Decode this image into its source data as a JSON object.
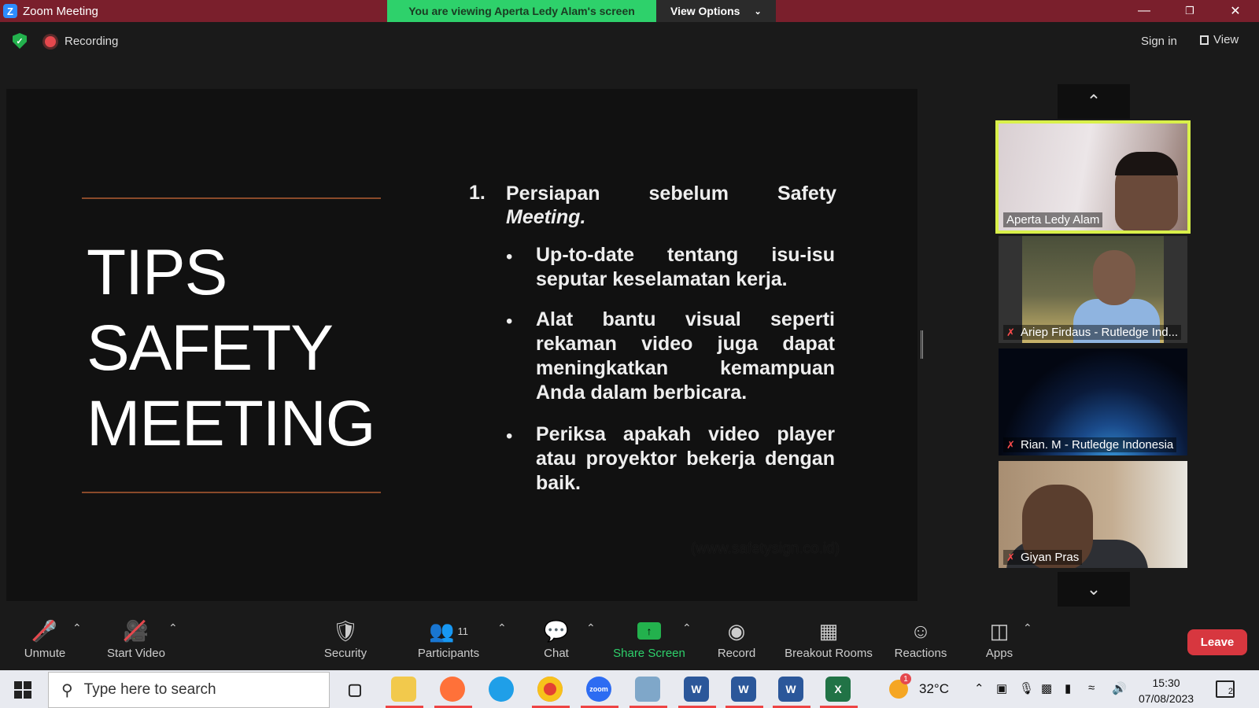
{
  "window": {
    "app_title": "Zoom Meeting",
    "logo_letter": "Z",
    "viewing_banner": "You are viewing Aperta Ledy Alam's screen",
    "view_options": "View Options",
    "minimize": "—",
    "restore": "❐",
    "close": "✕"
  },
  "meeting_bar": {
    "recording_label": "Recording",
    "sign_in": "Sign in",
    "view_label": "View"
  },
  "slide": {
    "title_lines": [
      "TIPS",
      "SAFETY",
      "MEETING"
    ],
    "point_number": "1.",
    "point_head_line1": "Persiapan sebelum Safety",
    "point_head_line2": "Meeting.",
    "bullets": [
      "Up-to-date tentang isu-isu seputar keselamatan kerja.",
      "Alat bantu visual seperti rekaman video juga dapat meningkatkan kemampuan Anda dalam berbicara.",
      "Periksa apakah video player atau proyektor bekerja dengan baik."
    ],
    "source": "(www.safetysign.co.id)"
  },
  "gallery": {
    "up_arrow": "⌃",
    "down_arrow": "⌄",
    "participants": [
      {
        "name": "Aperta Ledy Alam",
        "muted": false,
        "active": true
      },
      {
        "name": "Ariep Firdaus - Rutledge Ind...",
        "muted": true,
        "active": false
      },
      {
        "name": "Rian. M - Rutledge Indonesia",
        "muted": true,
        "active": false
      },
      {
        "name": "Giyan Pras",
        "muted": true,
        "active": false
      }
    ]
  },
  "toolbar": {
    "unmute": "Unmute",
    "start_video": "Start Video",
    "security": "Security",
    "participants": "Participants",
    "participants_count": "11",
    "chat": "Chat",
    "share_screen": "Share Screen",
    "record": "Record",
    "breakout_rooms": "Breakout Rooms",
    "reactions": "Reactions",
    "apps": "Apps",
    "leave": "Leave"
  },
  "taskbar": {
    "search_placeholder": "Type here to search",
    "weather_temp": "32°C",
    "weather_badge": "1",
    "time": "15:30",
    "date": "07/08/2023",
    "notification_count": "2"
  },
  "colors": {
    "titlebar": "#7a1f2c",
    "banner_green": "#2ed16b",
    "active_speaker_border": "#d9f04a",
    "leave_red": "#d7373f"
  }
}
